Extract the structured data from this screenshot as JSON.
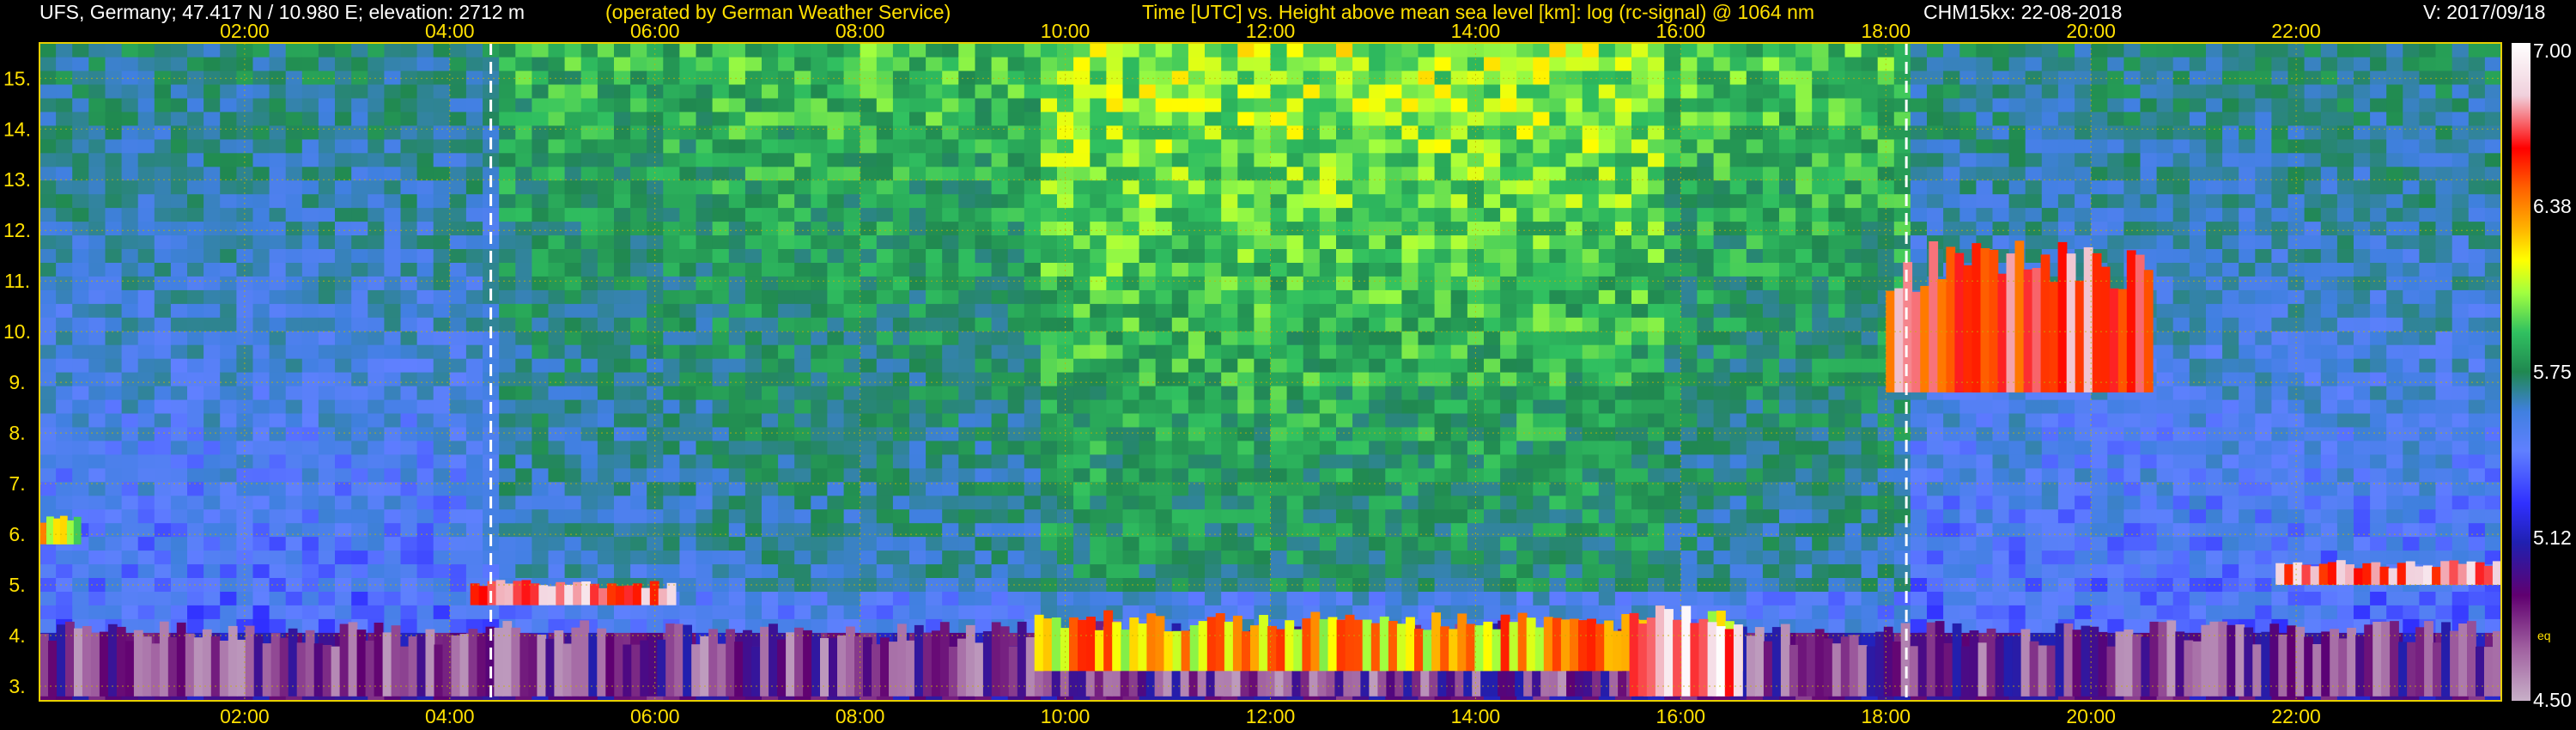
{
  "header": {
    "station": "UFS, Germany; 47.417 N / 10.980 E; elevation: 2712 m",
    "operator": "(operated by German Weather Service)",
    "axes_desc": "Time [UTC] vs. Height above mean sea level [km]: log (rc-signal) @ 1064 nm",
    "instrument_date": "CHM15kx: 22-08-2018",
    "version": "V: 2017/09/18"
  },
  "colorbar": {
    "ticks": [
      "7.00",
      "6.38",
      "5.75",
      "5.12",
      "4.50"
    ],
    "unit_label": "eq",
    "range": [
      4.5,
      7.0
    ]
  },
  "colors": {
    "frame": "#e8d000",
    "grid": "#c8b400",
    "header_white": "#ffffff",
    "header_yellow": "#ffe000",
    "marker_lines": "#ffffff"
  },
  "chart_data": {
    "type": "heatmap",
    "title": "Time [UTC] vs. Height above mean sea level [km]: log (rc-signal) @ 1064 nm",
    "xlabel": "Time [UTC]",
    "ylabel": "Height above mean sea level [km]",
    "x_tick_labels": [
      "02:00",
      "04:00",
      "06:00",
      "08:00",
      "10:00",
      "12:00",
      "14:00",
      "16:00",
      "18:00",
      "20:00",
      "22:00"
    ],
    "x_ticks_hours": [
      2,
      4,
      6,
      8,
      10,
      12,
      14,
      16,
      18,
      20,
      22
    ],
    "y_tick_labels": [
      "3.",
      "4.",
      "5.",
      "6.",
      "7.",
      "8.",
      "9.",
      "10.",
      "11.",
      "12.",
      "13.",
      "14.",
      "15."
    ],
    "y_ticks_km": [
      3,
      4,
      5,
      6,
      7,
      8,
      9,
      10,
      11,
      12,
      13,
      14,
      15
    ],
    "xlim_hours": [
      0,
      24
    ],
    "ylim_km": [
      2.712,
      15.7
    ],
    "grid": true,
    "vertical_markers_hours": [
      4.4,
      18.2
    ],
    "value_range": [
      4.5,
      7.0
    ],
    "features": [
      {
        "name": "surface layer",
        "t": [
          0,
          24
        ],
        "h": [
          2.8,
          4.3
        ],
        "level": 5.0
      },
      {
        "name": "cloud layer morning",
        "t": [
          4.2,
          6.2
        ],
        "h": [
          4.6,
          5.1
        ],
        "level": 6.9
      },
      {
        "name": "boundary layer clouds",
        "t": [
          9.7,
          16.6
        ],
        "h": [
          3.3,
          4.5
        ],
        "level": 6.5
      },
      {
        "name": "convective cloud",
        "t": [
          15.5,
          16.6
        ],
        "h": [
          2.8,
          4.6
        ],
        "level": 7.0
      },
      {
        "name": "cirrus",
        "t": [
          18.0,
          20.6
        ],
        "h": [
          8.8,
          11.8
        ],
        "level": 6.8
      },
      {
        "name": "evening cloud layer",
        "t": [
          21.8,
          24
        ],
        "h": [
          5.0,
          5.5
        ],
        "level": 6.9
      },
      {
        "name": "morning cloud patch",
        "t": [
          0,
          0.4
        ],
        "h": [
          5.8,
          6.4
        ],
        "level": 6.4
      }
    ]
  }
}
